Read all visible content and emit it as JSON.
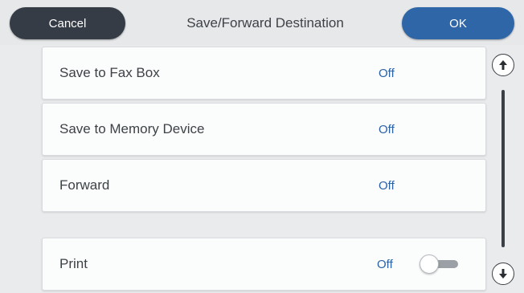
{
  "header": {
    "cancel_label": "Cancel",
    "title": "Save/Forward Destination",
    "ok_label": "OK"
  },
  "settings": [
    {
      "label": "Save to Fax Box",
      "value": "Off"
    },
    {
      "label": "Save to Memory Device",
      "value": "Off"
    },
    {
      "label": "Forward",
      "value": "Off"
    }
  ],
  "print": {
    "label": "Print",
    "value": "Off",
    "toggle_on": false
  },
  "scrollbar": {
    "up_icon": "arrow-up-icon",
    "down_icon": "arrow-down-icon"
  },
  "colors": {
    "cancel_button": "#353c45",
    "ok_button": "#2f66a8",
    "value_text": "#2a62a5"
  }
}
